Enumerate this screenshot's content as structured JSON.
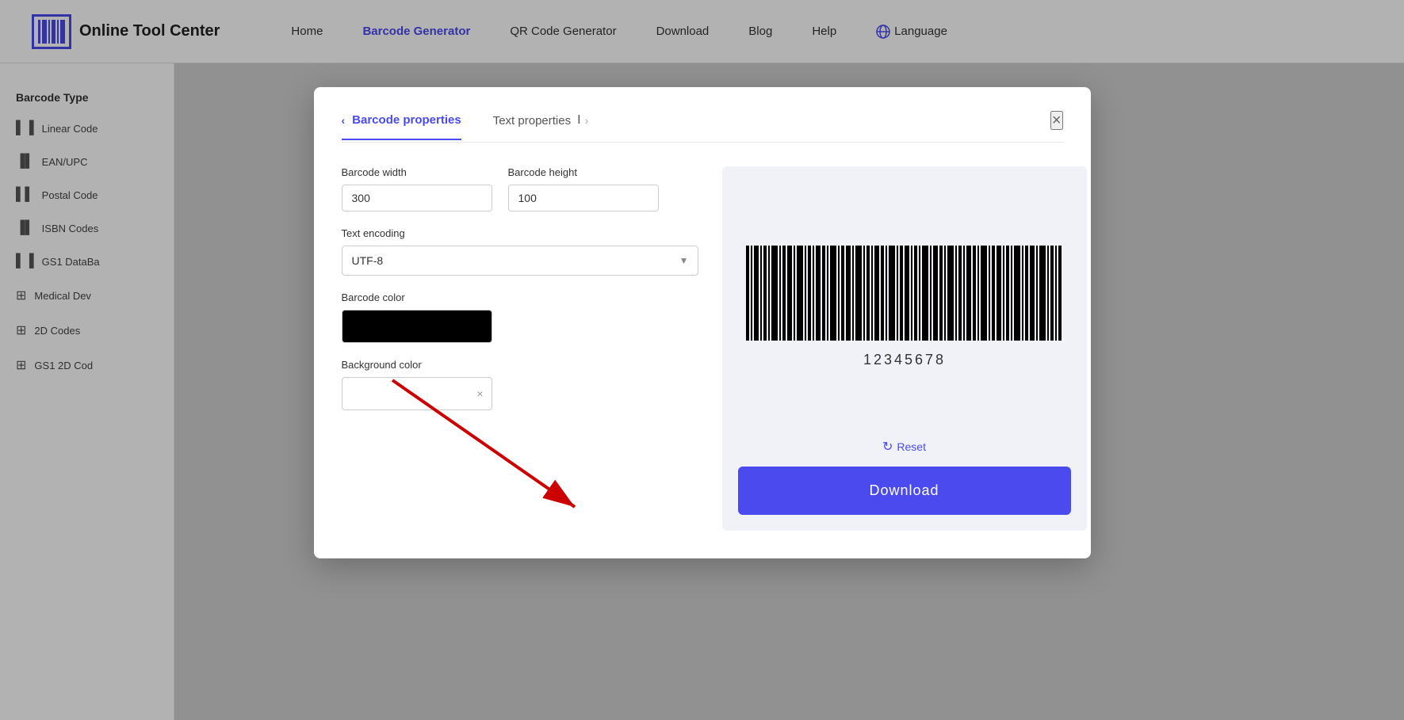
{
  "header": {
    "logo_text": "Online Tool Center",
    "nav": [
      {
        "label": "Home",
        "active": false
      },
      {
        "label": "Barcode Generator",
        "active": true
      },
      {
        "label": "QR Code Generator",
        "active": false
      },
      {
        "label": "Download",
        "active": false
      },
      {
        "label": "Blog",
        "active": false
      },
      {
        "label": "Help",
        "active": false
      }
    ],
    "language_label": "Language"
  },
  "sidebar": {
    "title": "Barcode Type",
    "items": [
      {
        "label": "Linear Code",
        "icon": "▌▌▌▌"
      },
      {
        "label": "EAN/UPC",
        "icon": "▌▌▌▌"
      },
      {
        "label": "Postal Code",
        "icon": "▌▌▌▌"
      },
      {
        "label": "ISBN Codes",
        "icon": "▌▌▌▌"
      },
      {
        "label": "GS1 DataBa",
        "icon": "▌▌▌▌"
      },
      {
        "label": "Medical Dev",
        "icon": "▌▌▌▌"
      },
      {
        "label": "2D Codes",
        "icon": "▌▌▌▌"
      },
      {
        "label": "GS1 2D Cod",
        "icon": "▌▌▌▌"
      }
    ]
  },
  "modal": {
    "tab_barcode_properties": "Barcode properties",
    "tab_text_properties": "Text properties",
    "close_label": "×",
    "fields": {
      "barcode_width_label": "Barcode width",
      "barcode_width_value": "300",
      "barcode_height_label": "Barcode height",
      "barcode_height_value": "100",
      "text_encoding_label": "Text encoding",
      "text_encoding_value": "UTF-8",
      "barcode_color_label": "Barcode color",
      "background_color_label": "Background color"
    },
    "barcode_number": "12345678",
    "reset_label": "Reset",
    "download_label": "Download"
  }
}
